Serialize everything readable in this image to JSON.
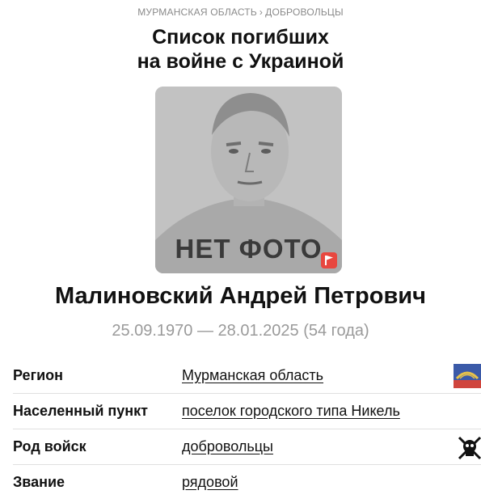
{
  "breadcrumb": {
    "items": [
      "Мурманская область",
      "Добровольцы"
    ],
    "separator": "›"
  },
  "title": {
    "line1": "Список погибших",
    "line2": "на войне с Украиной"
  },
  "photo": {
    "placeholder_text": "НЕТ ФОТО",
    "icon": "flag-icon"
  },
  "person": {
    "name": "Малиновский Андрей Петрович",
    "dates": "25.09.1970 — 28.01.2025 (54 года)"
  },
  "details": [
    {
      "label": "Регион",
      "value": "Мурманская область",
      "icon": "region-coat-of-arms-icon"
    },
    {
      "label": "Населенный пункт",
      "value": "поселок городского типа Никель"
    },
    {
      "label": "Род войск",
      "value": "добровольцы",
      "icon": "volunteers-emblem-icon"
    },
    {
      "label": "Звание",
      "value": "рядовой"
    }
  ],
  "colors": {
    "muted_text": "#9a9a9a",
    "flag_red": "#e8473f",
    "coat_blue": "#3b5aa8"
  }
}
